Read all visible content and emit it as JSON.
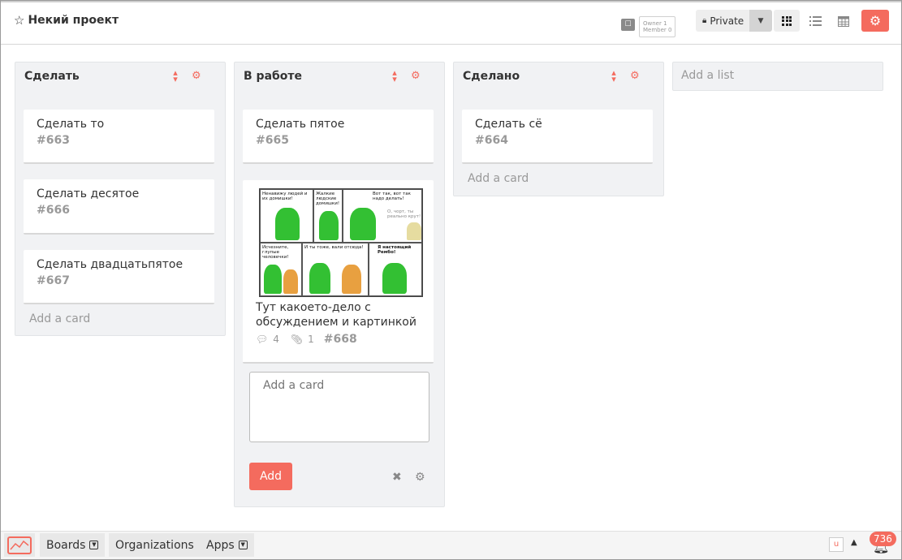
{
  "header": {
    "star_icon": "☆",
    "board_title": "Некий проект",
    "members_icon_text": "☐",
    "members": {
      "owner": "Owner 1",
      "member": "Member 0"
    },
    "privacy_label": "Private",
    "view_modes": [
      "grid-icon",
      "list-icon",
      "calendar-icon"
    ],
    "settings_icon": "gear-icon"
  },
  "lists": [
    {
      "title": "Сделать",
      "cards": [
        {
          "title": "Сделать то",
          "number": "#663"
        },
        {
          "title": "Сделать десятое",
          "number": "#666"
        },
        {
          "title": "Сделать двадцатьпятое",
          "number": "#667"
        }
      ],
      "add_card": "Add a card"
    },
    {
      "title": "В работе",
      "cards": [
        {
          "title": "Сделать пятое",
          "number": "#665"
        },
        {
          "title": "Тут какоето-дело с обсуждением и картинкой",
          "number": "#668",
          "comments": "4",
          "attachments": "1",
          "comic_texts": [
            "Ненавижу людей и их домишки!",
            "Жалкие людские домишки!",
            "Вот так, вот так надо делать!",
            "О, чорт, ты реально крут!",
            "Исчезните, глупые человечки!",
            "И ты тоже, вали отсюда!",
            "Я настоящий Рембо!"
          ]
        }
      ],
      "add_card_placeholder": "Add a card",
      "add_button": "Add"
    },
    {
      "title": "Сделано",
      "cards": [
        {
          "title": "Сделать сё",
          "number": "#664"
        }
      ],
      "add_card": "Add a card"
    }
  ],
  "add_list": "Add a list",
  "footer": {
    "boards": "Boards",
    "organizations": "Organizations",
    "apps": "Apps",
    "u_icon": "u",
    "notification_count": "736"
  },
  "colors": {
    "accent": "#f46b5e",
    "list_bg": "#f1f2f4",
    "text": "#333333",
    "muted": "#999999"
  }
}
